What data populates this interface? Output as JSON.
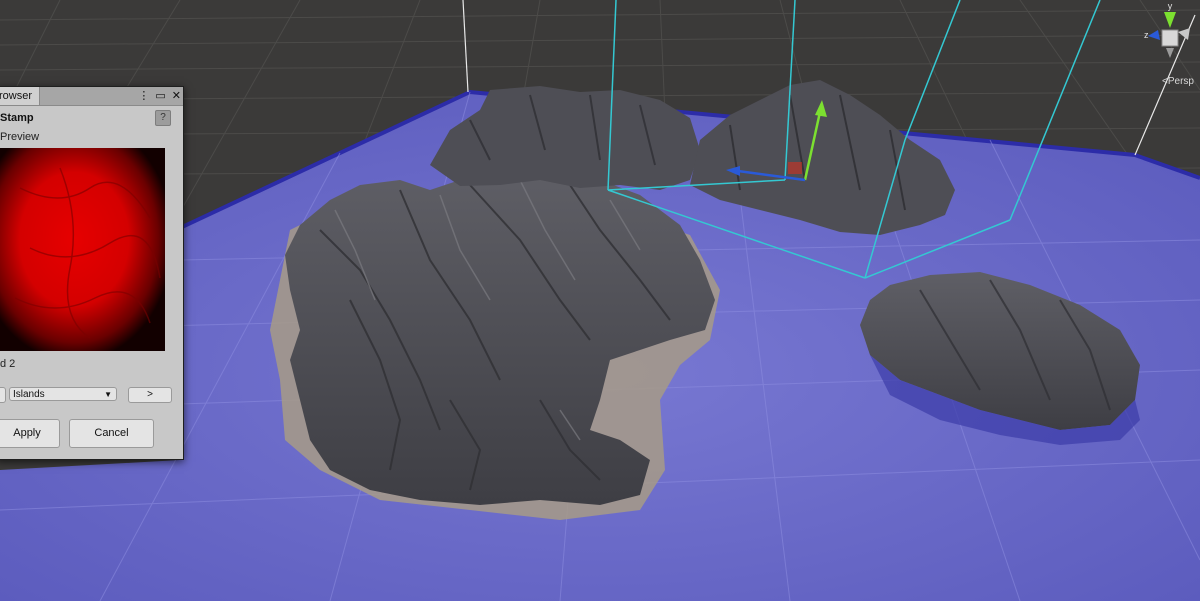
{
  "panel": {
    "tab_label": "rowser",
    "title": "Stamp",
    "help_label": "?",
    "preview_label": "Preview",
    "stamp_name": "d 2",
    "category": "Islands",
    "next_label": ">",
    "apply_label": "Apply",
    "cancel_label": "Cancel"
  },
  "viewport": {
    "persp_label": "<Persp",
    "axis_labels": {
      "y": "y",
      "z": "z"
    }
  },
  "colors": {
    "ground": "#3b3a39",
    "sea": "#6868c8",
    "terrain": "#55555a",
    "selection_box": "#34c8d2",
    "gizmo_x": "#d03020",
    "gizmo_y": "#7ce030",
    "gizmo_z": "#2a5ad8"
  }
}
